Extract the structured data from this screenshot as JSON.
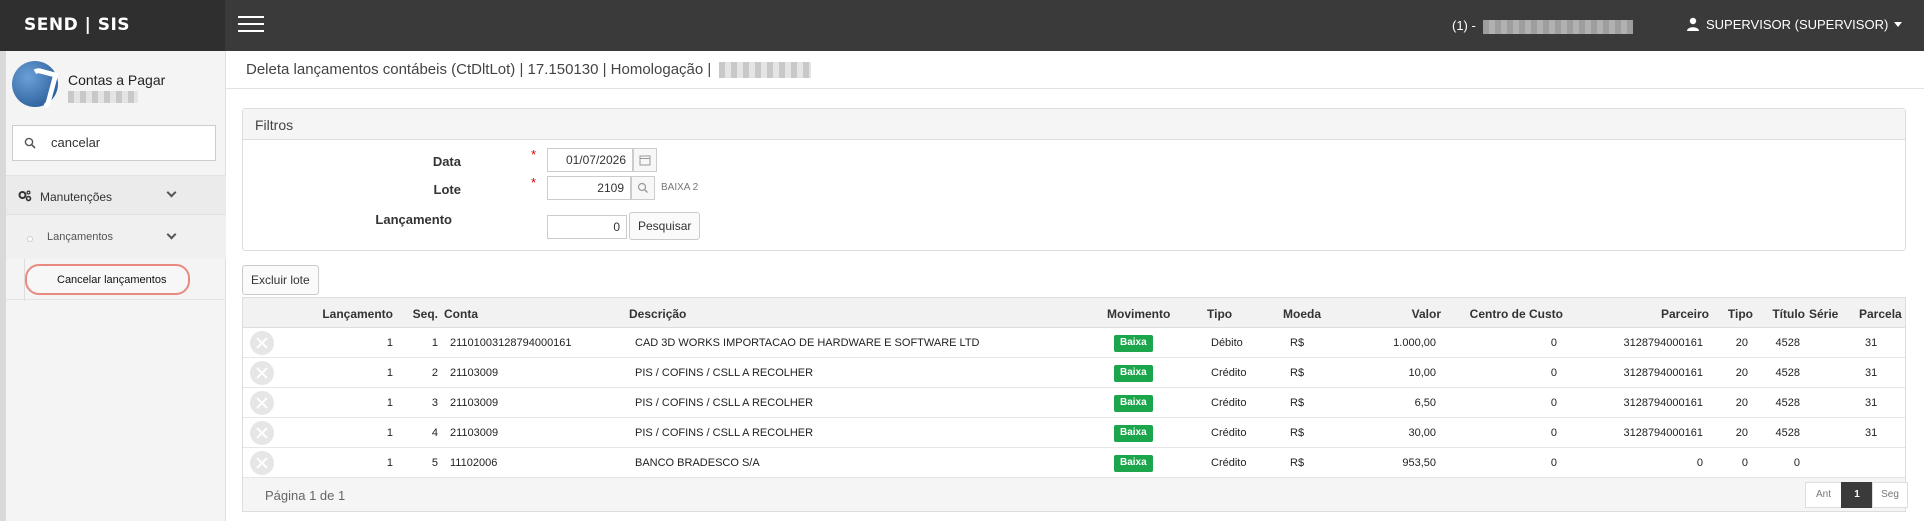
{
  "brand": "SEND | SIS",
  "header": {
    "company": "(1) - ",
    "user": "SUPERVISOR (SUPERVISOR)"
  },
  "sidebar": {
    "module_title": "Contas a Pagar",
    "search_value": "cancelar",
    "menu": {
      "manutencoes": "Manutenções",
      "lancamentos": "Lançamentos",
      "cancelar": "Cancelar lançamentos"
    }
  },
  "page": {
    "title": "Deleta lançamentos contábeis (CtDltLot) | 17.150130 | Homologação | "
  },
  "filters": {
    "title": "Filtros",
    "data_label": "Data",
    "data_value": "01/07/2026",
    "lote_label": "Lote",
    "lote_value": "2109",
    "lote_hint": "BAIXA 2",
    "lancamento_label": "Lançamento",
    "lancamento_value": "0",
    "search_button": "Pesquisar",
    "required_mark": "*"
  },
  "actions": {
    "delete_batch": "Excluir lote"
  },
  "table": {
    "columns": [
      "Lançamento",
      "Seq.",
      "Conta",
      "Descrição",
      "Movimento",
      "Tipo",
      "Moeda",
      "Valor",
      "Centro de Custo",
      "Parceiro",
      "Tipo",
      "Título",
      "Série",
      "Parcela"
    ],
    "rows": [
      {
        "lancamento": "1",
        "seq": "1",
        "conta": "21101003128794000161",
        "descricao": "CAD 3D WORKS IMPORTACAO DE HARDWARE E SOFTWARE LTD",
        "movimento": "Baixa",
        "tipo": "Débito",
        "moeda": "R$",
        "valor": "1.000,00",
        "centro": "0",
        "parceiro": "3128794000161",
        "tipo2": "20",
        "titulo": "4528",
        "serie": "",
        "parcela": "31"
      },
      {
        "lancamento": "1",
        "seq": "2",
        "conta": "21103009",
        "descricao": "PIS / COFINS / CSLL A RECOLHER",
        "movimento": "Baixa",
        "tipo": "Crédito",
        "moeda": "R$",
        "valor": "10,00",
        "centro": "0",
        "parceiro": "3128794000161",
        "tipo2": "20",
        "titulo": "4528",
        "serie": "",
        "parcela": "31"
      },
      {
        "lancamento": "1",
        "seq": "3",
        "conta": "21103009",
        "descricao": "PIS / COFINS / CSLL A RECOLHER",
        "movimento": "Baixa",
        "tipo": "Crédito",
        "moeda": "R$",
        "valor": "6,50",
        "centro": "0",
        "parceiro": "3128794000161",
        "tipo2": "20",
        "titulo": "4528",
        "serie": "",
        "parcela": "31"
      },
      {
        "lancamento": "1",
        "seq": "4",
        "conta": "21103009",
        "descricao": "PIS / COFINS / CSLL A RECOLHER",
        "movimento": "Baixa",
        "tipo": "Crédito",
        "moeda": "R$",
        "valor": "30,00",
        "centro": "0",
        "parceiro": "3128794000161",
        "tipo2": "20",
        "titulo": "4528",
        "serie": "",
        "parcela": "31"
      },
      {
        "lancamento": "1",
        "seq": "5",
        "conta": "11102006",
        "descricao": "BANCO BRADESCO S/A",
        "movimento": "Baixa",
        "tipo": "Crédito",
        "moeda": "R$",
        "valor": "953,50",
        "centro": "0",
        "parceiro": "0",
        "tipo2": "0",
        "titulo": "0",
        "serie": "",
        "parcela": ""
      }
    ]
  },
  "pagination": {
    "label": "Página 1 de 1",
    "prev": "Ant",
    "current": "1",
    "next": "Seg"
  },
  "colors": {
    "topbar": "#3a3a3a",
    "badge_green": "#1ba64b",
    "highlight_ring": "#e88a80"
  }
}
